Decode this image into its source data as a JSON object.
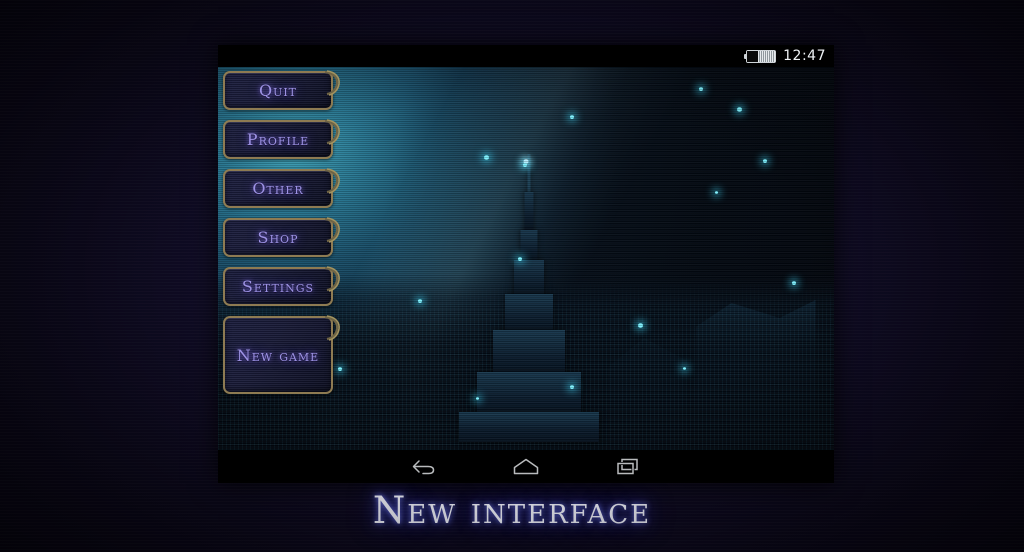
{
  "desktop": {
    "background_color": "#100c26"
  },
  "device": {
    "statusbar": {
      "clock": "12:47",
      "battery_icon": "battery-icon"
    },
    "navbar": {
      "back_label": "Back",
      "home_label": "Home",
      "recents_label": "Recent apps",
      "back_icon": "back-arrow-icon",
      "home_icon": "home-icon",
      "recents_icon": "recents-icon"
    },
    "menu": {
      "buttons": [
        {
          "label": "Quit"
        },
        {
          "label": "Profile"
        },
        {
          "label": "Other"
        },
        {
          "label": "Shop"
        },
        {
          "label": "Settings"
        },
        {
          "label": "New game"
        }
      ]
    },
    "scene": {
      "name": "fantasy-city-spire-artwork",
      "accent_glow": "#7ff2ff",
      "sky_color": "#2e92ab"
    }
  },
  "caption": {
    "text": "New interface",
    "color": "#f4f5ff",
    "glow_color": "#7882ff"
  }
}
